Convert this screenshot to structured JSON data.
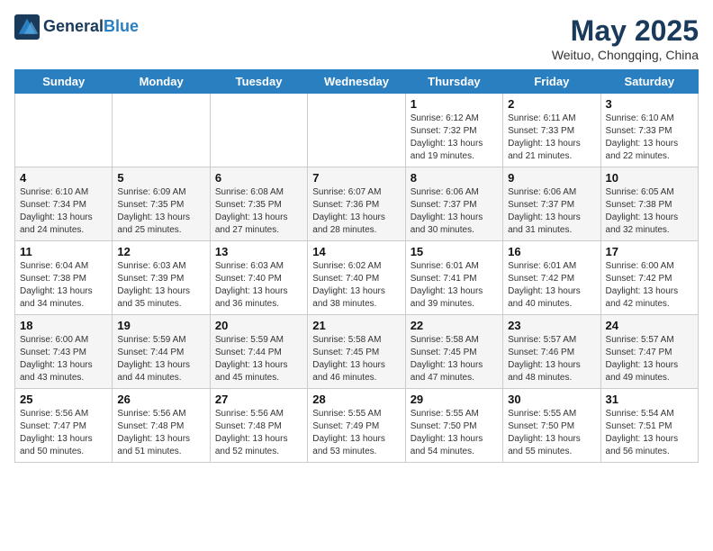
{
  "header": {
    "logo_general": "General",
    "logo_blue": "Blue",
    "month_title": "May 2025",
    "location": "Weituo, Chongqing, China"
  },
  "days_of_week": [
    "Sunday",
    "Monday",
    "Tuesday",
    "Wednesday",
    "Thursday",
    "Friday",
    "Saturday"
  ],
  "weeks": [
    [
      {
        "day": "",
        "info": ""
      },
      {
        "day": "",
        "info": ""
      },
      {
        "day": "",
        "info": ""
      },
      {
        "day": "",
        "info": ""
      },
      {
        "day": "1",
        "info": "Sunrise: 6:12 AM\nSunset: 7:32 PM\nDaylight: 13 hours\nand 19 minutes."
      },
      {
        "day": "2",
        "info": "Sunrise: 6:11 AM\nSunset: 7:33 PM\nDaylight: 13 hours\nand 21 minutes."
      },
      {
        "day": "3",
        "info": "Sunrise: 6:10 AM\nSunset: 7:33 PM\nDaylight: 13 hours\nand 22 minutes."
      }
    ],
    [
      {
        "day": "4",
        "info": "Sunrise: 6:10 AM\nSunset: 7:34 PM\nDaylight: 13 hours\nand 24 minutes."
      },
      {
        "day": "5",
        "info": "Sunrise: 6:09 AM\nSunset: 7:35 PM\nDaylight: 13 hours\nand 25 minutes."
      },
      {
        "day": "6",
        "info": "Sunrise: 6:08 AM\nSunset: 7:35 PM\nDaylight: 13 hours\nand 27 minutes."
      },
      {
        "day": "7",
        "info": "Sunrise: 6:07 AM\nSunset: 7:36 PM\nDaylight: 13 hours\nand 28 minutes."
      },
      {
        "day": "8",
        "info": "Sunrise: 6:06 AM\nSunset: 7:37 PM\nDaylight: 13 hours\nand 30 minutes."
      },
      {
        "day": "9",
        "info": "Sunrise: 6:06 AM\nSunset: 7:37 PM\nDaylight: 13 hours\nand 31 minutes."
      },
      {
        "day": "10",
        "info": "Sunrise: 6:05 AM\nSunset: 7:38 PM\nDaylight: 13 hours\nand 32 minutes."
      }
    ],
    [
      {
        "day": "11",
        "info": "Sunrise: 6:04 AM\nSunset: 7:38 PM\nDaylight: 13 hours\nand 34 minutes."
      },
      {
        "day": "12",
        "info": "Sunrise: 6:03 AM\nSunset: 7:39 PM\nDaylight: 13 hours\nand 35 minutes."
      },
      {
        "day": "13",
        "info": "Sunrise: 6:03 AM\nSunset: 7:40 PM\nDaylight: 13 hours\nand 36 minutes."
      },
      {
        "day": "14",
        "info": "Sunrise: 6:02 AM\nSunset: 7:40 PM\nDaylight: 13 hours\nand 38 minutes."
      },
      {
        "day": "15",
        "info": "Sunrise: 6:01 AM\nSunset: 7:41 PM\nDaylight: 13 hours\nand 39 minutes."
      },
      {
        "day": "16",
        "info": "Sunrise: 6:01 AM\nSunset: 7:42 PM\nDaylight: 13 hours\nand 40 minutes."
      },
      {
        "day": "17",
        "info": "Sunrise: 6:00 AM\nSunset: 7:42 PM\nDaylight: 13 hours\nand 42 minutes."
      }
    ],
    [
      {
        "day": "18",
        "info": "Sunrise: 6:00 AM\nSunset: 7:43 PM\nDaylight: 13 hours\nand 43 minutes."
      },
      {
        "day": "19",
        "info": "Sunrise: 5:59 AM\nSunset: 7:44 PM\nDaylight: 13 hours\nand 44 minutes."
      },
      {
        "day": "20",
        "info": "Sunrise: 5:59 AM\nSunset: 7:44 PM\nDaylight: 13 hours\nand 45 minutes."
      },
      {
        "day": "21",
        "info": "Sunrise: 5:58 AM\nSunset: 7:45 PM\nDaylight: 13 hours\nand 46 minutes."
      },
      {
        "day": "22",
        "info": "Sunrise: 5:58 AM\nSunset: 7:45 PM\nDaylight: 13 hours\nand 47 minutes."
      },
      {
        "day": "23",
        "info": "Sunrise: 5:57 AM\nSunset: 7:46 PM\nDaylight: 13 hours\nand 48 minutes."
      },
      {
        "day": "24",
        "info": "Sunrise: 5:57 AM\nSunset: 7:47 PM\nDaylight: 13 hours\nand 49 minutes."
      }
    ],
    [
      {
        "day": "25",
        "info": "Sunrise: 5:56 AM\nSunset: 7:47 PM\nDaylight: 13 hours\nand 50 minutes."
      },
      {
        "day": "26",
        "info": "Sunrise: 5:56 AM\nSunset: 7:48 PM\nDaylight: 13 hours\nand 51 minutes."
      },
      {
        "day": "27",
        "info": "Sunrise: 5:56 AM\nSunset: 7:48 PM\nDaylight: 13 hours\nand 52 minutes."
      },
      {
        "day": "28",
        "info": "Sunrise: 5:55 AM\nSunset: 7:49 PM\nDaylight: 13 hours\nand 53 minutes."
      },
      {
        "day": "29",
        "info": "Sunrise: 5:55 AM\nSunset: 7:50 PM\nDaylight: 13 hours\nand 54 minutes."
      },
      {
        "day": "30",
        "info": "Sunrise: 5:55 AM\nSunset: 7:50 PM\nDaylight: 13 hours\nand 55 minutes."
      },
      {
        "day": "31",
        "info": "Sunrise: 5:54 AM\nSunset: 7:51 PM\nDaylight: 13 hours\nand 56 minutes."
      }
    ]
  ]
}
